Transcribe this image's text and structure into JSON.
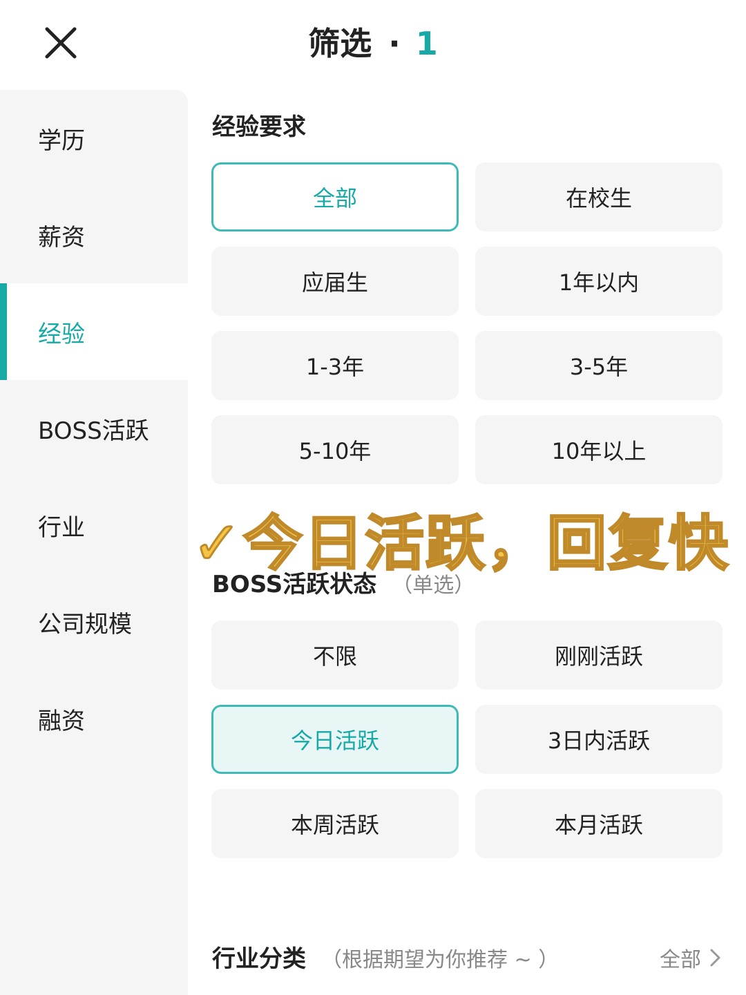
{
  "header": {
    "title": "筛选",
    "separator": "·",
    "count": "1"
  },
  "sidebar": {
    "items": [
      {
        "label": "学历"
      },
      {
        "label": "薪资"
      },
      {
        "label": "经验",
        "active": true
      },
      {
        "label": "BOSS活跃"
      },
      {
        "label": "行业"
      },
      {
        "label": "公司规模"
      },
      {
        "label": "融资"
      }
    ]
  },
  "experience": {
    "title": "经验要求",
    "options": [
      "全部",
      "在校生",
      "应届生",
      "1年以内",
      "1-3年",
      "3-5年",
      "5-10年",
      "10年以上"
    ],
    "selected": "全部"
  },
  "overlay": {
    "text": "✓今日活跃，回复快"
  },
  "boss_active": {
    "title": "BOSS活跃状态",
    "hint": "（单选）",
    "options": [
      "不限",
      "刚刚活跃",
      "今日活跃",
      "3日内活跃",
      "本周活跃",
      "本月活跃"
    ],
    "selected": "今日活跃"
  },
  "industry": {
    "title": "行业分类",
    "hint": "（根据期望为你推荐 ~ ）",
    "all_label": "全部"
  },
  "colors": {
    "accent": "#16a9a6",
    "option_bg": "#f5f5f5",
    "selected_bg": "#e8f7f5",
    "overlay_text": "#f4c545"
  }
}
